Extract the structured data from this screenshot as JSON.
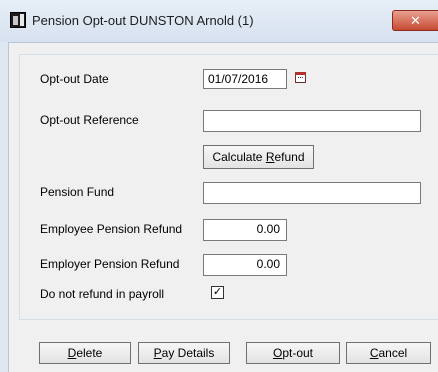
{
  "window": {
    "title": "Pension Opt-out DUNSTON Arnold (1)",
    "close_glyph": "✕"
  },
  "form": {
    "optout_date_label": "Opt-out Date",
    "optout_date_value": "01/07/2016",
    "optout_reference_label": "Opt-out Reference",
    "optout_reference_value": "",
    "calculate_refund": {
      "pre": "Calculate ",
      "key": "R",
      "post": "efund"
    },
    "pension_fund_label": "Pension Fund",
    "pension_fund_value": "",
    "employee_refund_label": "Employee Pension Refund",
    "employee_refund_value": "0.00",
    "employer_refund_label": "Employer Pension Refund",
    "employer_refund_value": "0.00",
    "do_not_refund_label": "Do not refund in payroll",
    "do_not_refund_checked": true,
    "checkmark": "✓"
  },
  "buttons": {
    "delete": {
      "key": "D",
      "rest": "elete"
    },
    "pay_details": {
      "key": "P",
      "rest": "ay Details"
    },
    "optout": {
      "key": "O",
      "rest": "pt-out"
    },
    "cancel": {
      "key": "C",
      "rest": "ancel"
    }
  },
  "icons": {
    "app": "app-icon",
    "calendar": "calendar-icon",
    "close": "close-icon"
  }
}
